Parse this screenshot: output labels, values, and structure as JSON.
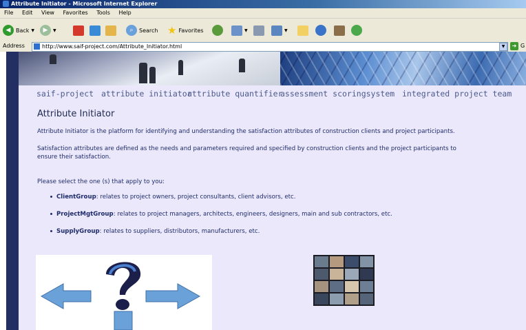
{
  "window": {
    "title": "Attribute Initiator - Microsoft Internet Explorer"
  },
  "menu": [
    "File",
    "Edit",
    "View",
    "Favorites",
    "Tools",
    "Help"
  ],
  "toolbar": {
    "back": "Back",
    "search": "Search",
    "favorites": "Favorites"
  },
  "address": {
    "label": "Address",
    "url": "http://www.saif-project.com/Attribute_Initiator.html",
    "go": "G"
  },
  "nav": [
    "saif-project",
    "attribute initiator",
    "attribute quantifier",
    "assessment scoringsystem",
    "integrated project team"
  ],
  "page": {
    "title": "Attribute Initiator",
    "para1": "Attribute Initiator is the platform for identifying and understanding the satisfaction attributes of construction clients and project participants.",
    "para2_line1": "Satisfaction attributes are defined as the needs and parameters required and specified by construction clients and the project participants to",
    "para2_line2": "ensure their satisfaction.",
    "prompt": "Please select the one (s) that apply to you:",
    "groups": [
      {
        "name": "ClientGroup",
        "desc": ": relates to project owners, project consultants, client advisors, etc."
      },
      {
        "name": "ProjectMgtGroup",
        "desc": ": relates to project managers, architects, engineers, designers, main and sub contractors, etc."
      },
      {
        "name": "SupplyGroup",
        "desc": ": relates to suppliers, distributors, manufacturers, etc."
      }
    ]
  },
  "colors": {
    "nav_text": "#4a5a8c",
    "body_text": "#1d2b6b",
    "page_bg": "#ece8fb",
    "left_strip": "#232e63"
  }
}
